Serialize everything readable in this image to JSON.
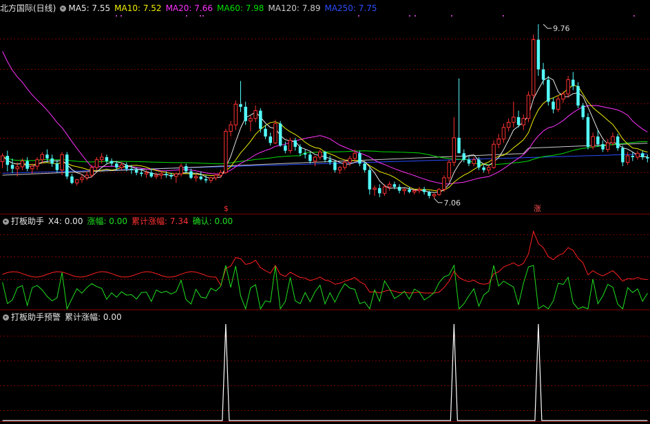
{
  "colors": {
    "bg": "#000000",
    "grid": "#7a0000",
    "up": "#ff3232",
    "down": "#54ffff",
    "ma5": "#e8e8e8",
    "ma10": "#f0f000",
    "ma20": "#ff33ff",
    "ma60": "#00e000",
    "ma120": "#cccccc",
    "ma250": "#2b4dff",
    "x4": "#ff2020",
    "zf": "#20e020",
    "alarm": "#ffffff"
  },
  "panel1": {
    "title": "北方国际(日线)",
    "ma5": "MA5: 7.55",
    "ma10": "MA10: 7.52",
    "ma20": "MA20: 7.66",
    "ma60": "MA60: 7.98",
    "ma120": "MA120: 7.89",
    "ma250": "MA250: 7.75"
  },
  "panel2": {
    "title": "打板助手",
    "x4": "X4: 0.00",
    "zf": "涨幅: 0.00",
    "ljzf": "累计涨幅: 7.34",
    "qr": "确认: 0.00"
  },
  "panel3": {
    "title": "打板助手预警",
    "ljzf": "累计涨幅: 0.00"
  },
  "chart_data": {
    "type": "candlestick",
    "price_range": [
      6.93,
      9.9
    ],
    "annotations": [
      {
        "text": "9.76",
        "index": 109,
        "value": 9.76
      },
      {
        "text": "7.06",
        "index": 87,
        "value": 7.06
      },
      {
        "text": "$",
        "index": 45,
        "value": 6.93
      },
      {
        "text": "涨",
        "index": 108,
        "value": 6.93
      }
    ],
    "candles": [
      [
        7.63,
        7.76,
        7.53,
        7.72
      ],
      [
        7.72,
        7.8,
        7.48,
        7.58
      ],
      [
        7.58,
        7.68,
        7.45,
        7.52
      ],
      [
        7.52,
        7.62,
        7.4,
        7.55
      ],
      [
        7.55,
        7.68,
        7.5,
        7.64
      ],
      [
        7.64,
        7.7,
        7.48,
        7.52
      ],
      [
        7.52,
        7.6,
        7.44,
        7.56
      ],
      [
        7.56,
        7.7,
        7.5,
        7.66
      ],
      [
        7.66,
        7.78,
        7.6,
        7.74
      ],
      [
        7.74,
        7.82,
        7.62,
        7.68
      ],
      [
        7.68,
        7.74,
        7.55,
        7.6
      ],
      [
        7.6,
        7.66,
        7.46,
        7.5
      ],
      [
        7.5,
        7.78,
        7.42,
        7.74
      ],
      [
        7.74,
        7.78,
        7.36,
        7.4
      ],
      [
        7.4,
        7.44,
        7.28,
        7.3
      ],
      [
        7.3,
        7.36,
        7.26,
        7.35
      ],
      [
        7.35,
        7.44,
        7.3,
        7.38
      ],
      [
        7.38,
        7.48,
        7.34,
        7.42
      ],
      [
        7.42,
        7.58,
        7.38,
        7.54
      ],
      [
        7.54,
        7.7,
        7.5,
        7.66
      ],
      [
        7.66,
        7.76,
        7.6,
        7.7
      ],
      [
        7.7,
        7.74,
        7.6,
        7.64
      ],
      [
        7.64,
        7.68,
        7.56,
        7.6
      ],
      [
        7.6,
        7.64,
        7.5,
        7.54
      ],
      [
        7.54,
        7.62,
        7.5,
        7.58
      ],
      [
        7.58,
        7.62,
        7.48,
        7.52
      ],
      [
        7.52,
        7.58,
        7.44,
        7.5
      ],
      [
        7.5,
        7.54,
        7.42,
        7.46
      ],
      [
        7.46,
        7.52,
        7.4,
        7.44
      ],
      [
        7.44,
        7.5,
        7.38,
        7.46
      ],
      [
        7.46,
        7.52,
        7.38,
        7.4
      ],
      [
        7.4,
        7.46,
        7.36,
        7.42
      ],
      [
        7.42,
        7.48,
        7.36,
        7.44
      ],
      [
        7.44,
        7.48,
        7.38,
        7.42
      ],
      [
        7.42,
        7.46,
        7.36,
        7.4
      ],
      [
        7.4,
        7.46,
        7.3,
        7.44
      ],
      [
        7.44,
        7.6,
        7.4,
        7.56
      ],
      [
        7.56,
        7.6,
        7.46,
        7.48
      ],
      [
        7.48,
        7.52,
        7.36,
        7.38
      ],
      [
        7.38,
        7.44,
        7.32,
        7.4
      ],
      [
        7.4,
        7.48,
        7.34,
        7.36
      ],
      [
        7.36,
        7.42,
        7.3,
        7.34
      ],
      [
        7.34,
        7.4,
        7.3,
        7.38
      ],
      [
        7.38,
        7.44,
        7.34,
        7.42
      ],
      [
        7.42,
        7.5,
        7.38,
        7.46
      ],
      [
        7.46,
        8.14,
        7.44,
        8.1
      ],
      [
        8.1,
        8.26,
        8.02,
        8.2
      ],
      [
        8.2,
        8.58,
        8.12,
        8.52
      ],
      [
        8.52,
        8.88,
        8.4,
        8.48
      ],
      [
        8.48,
        8.56,
        8.2,
        8.26
      ],
      [
        8.26,
        8.34,
        8.1,
        8.3
      ],
      [
        8.3,
        8.5,
        8.24,
        8.42
      ],
      [
        8.42,
        8.46,
        8.08,
        8.14
      ],
      [
        8.14,
        8.2,
        7.98,
        8.02
      ],
      [
        8.02,
        8.08,
        7.88,
        7.92
      ],
      [
        7.92,
        8.28,
        7.9,
        8.22
      ],
      [
        8.22,
        8.26,
        7.86,
        7.88
      ],
      [
        7.88,
        7.94,
        7.76,
        7.8
      ],
      [
        7.8,
        8.0,
        7.76,
        7.96
      ],
      [
        7.96,
        8.0,
        7.8,
        7.86
      ],
      [
        7.86,
        7.9,
        7.72,
        7.76
      ],
      [
        7.76,
        7.82,
        7.68,
        7.74
      ],
      [
        7.74,
        7.78,
        7.6,
        7.64
      ],
      [
        7.64,
        7.72,
        7.56,
        7.7
      ],
      [
        7.7,
        7.82,
        7.66,
        7.78
      ],
      [
        7.78,
        7.8,
        7.62,
        7.66
      ],
      [
        7.66,
        7.72,
        7.58,
        7.62
      ],
      [
        7.62,
        7.66,
        7.46,
        7.5
      ],
      [
        7.5,
        7.56,
        7.44,
        7.54
      ],
      [
        7.54,
        7.66,
        7.5,
        7.62
      ],
      [
        7.62,
        7.72,
        7.56,
        7.68
      ],
      [
        7.68,
        7.82,
        7.62,
        7.76
      ],
      [
        7.76,
        7.8,
        7.56,
        7.6
      ],
      [
        7.6,
        7.64,
        7.46,
        7.5
      ],
      [
        7.5,
        7.54,
        7.12,
        7.2
      ],
      [
        7.2,
        7.26,
        7.1,
        7.22
      ],
      [
        7.22,
        7.28,
        7.08,
        7.14
      ],
      [
        7.14,
        7.28,
        7.1,
        7.24
      ],
      [
        7.24,
        7.32,
        7.18,
        7.28
      ],
      [
        7.28,
        7.32,
        7.2,
        7.24
      ],
      [
        7.24,
        7.28,
        7.14,
        7.18
      ],
      [
        7.18,
        7.22,
        7.12,
        7.2
      ],
      [
        7.2,
        7.24,
        7.14,
        7.16
      ],
      [
        7.16,
        7.2,
        7.12,
        7.18
      ],
      [
        7.18,
        7.24,
        7.14,
        7.2
      ],
      [
        7.2,
        7.24,
        7.12,
        7.16
      ],
      [
        7.16,
        7.18,
        7.06,
        7.1
      ],
      [
        7.1,
        7.14,
        7.06,
        7.12
      ],
      [
        7.12,
        7.22,
        7.1,
        7.2
      ],
      [
        7.2,
        7.42,
        7.16,
        7.38
      ],
      [
        7.38,
        7.66,
        7.32,
        7.62
      ],
      [
        7.62,
        8.32,
        7.56,
        8.0
      ],
      [
        8.0,
        8.92,
        7.9,
        7.76
      ],
      [
        7.76,
        7.82,
        7.62,
        7.66
      ],
      [
        7.66,
        7.72,
        7.56,
        7.6
      ],
      [
        7.6,
        7.7,
        7.56,
        7.66
      ],
      [
        7.66,
        7.7,
        7.5,
        7.54
      ],
      [
        7.54,
        7.58,
        7.46,
        7.5
      ],
      [
        7.5,
        7.58,
        7.44,
        7.54
      ],
      [
        7.54,
        7.96,
        7.52,
        7.9
      ],
      [
        7.9,
        8.06,
        7.84,
        7.98
      ],
      [
        7.98,
        8.22,
        7.92,
        8.16
      ],
      [
        8.16,
        8.3,
        8.1,
        8.24
      ],
      [
        8.24,
        8.56,
        8.16,
        8.32
      ],
      [
        8.32,
        8.42,
        8.16,
        8.2
      ],
      [
        8.2,
        8.36,
        8.12,
        8.3
      ],
      [
        8.3,
        8.72,
        8.24,
        8.66
      ],
      [
        8.66,
        9.6,
        8.6,
        9.52
      ],
      [
        9.52,
        9.76,
        8.96,
        9.06
      ],
      [
        9.06,
        9.16,
        8.82,
        8.9
      ],
      [
        8.9,
        8.96,
        8.5,
        8.56
      ],
      [
        8.56,
        8.62,
        8.38,
        8.44
      ],
      [
        8.44,
        8.66,
        8.4,
        8.6
      ],
      [
        8.6,
        8.72,
        8.54,
        8.68
      ],
      [
        8.68,
        8.96,
        8.62,
        8.9
      ],
      [
        8.9,
        9.02,
        8.74,
        8.8
      ],
      [
        8.8,
        8.86,
        8.46,
        8.5
      ],
      [
        8.5,
        8.54,
        8.28,
        8.32
      ],
      [
        8.32,
        8.38,
        7.82,
        7.86
      ],
      [
        7.86,
        8.08,
        7.82,
        8.02
      ],
      [
        8.02,
        8.12,
        7.86,
        7.9
      ],
      [
        7.9,
        7.96,
        7.78,
        7.82
      ],
      [
        7.82,
        7.98,
        7.78,
        7.92
      ],
      [
        7.92,
        8.08,
        7.88,
        8.02
      ],
      [
        8.02,
        8.06,
        7.8,
        7.84
      ],
      [
        7.84,
        7.88,
        7.56,
        7.62
      ],
      [
        7.62,
        7.78,
        7.58,
        7.72
      ],
      [
        7.72,
        7.78,
        7.64,
        7.7
      ],
      [
        7.7,
        7.8,
        7.66,
        7.76
      ],
      [
        7.76,
        7.8,
        7.66,
        7.7
      ],
      [
        7.7,
        7.74,
        7.62,
        7.68
      ]
    ],
    "ma_end_values": {
      "MA5": 7.55,
      "MA10": 7.52,
      "MA20": 7.66,
      "MA60": 7.98,
      "MA120": 7.89,
      "MA250": 7.75
    },
    "indicator_end_values": {
      "X4": 0.0,
      "涨幅": 0.0,
      "累计涨幅": 7.34,
      "确认": 0.0
    },
    "alarm_indices": [
      45,
      91,
      108
    ]
  }
}
